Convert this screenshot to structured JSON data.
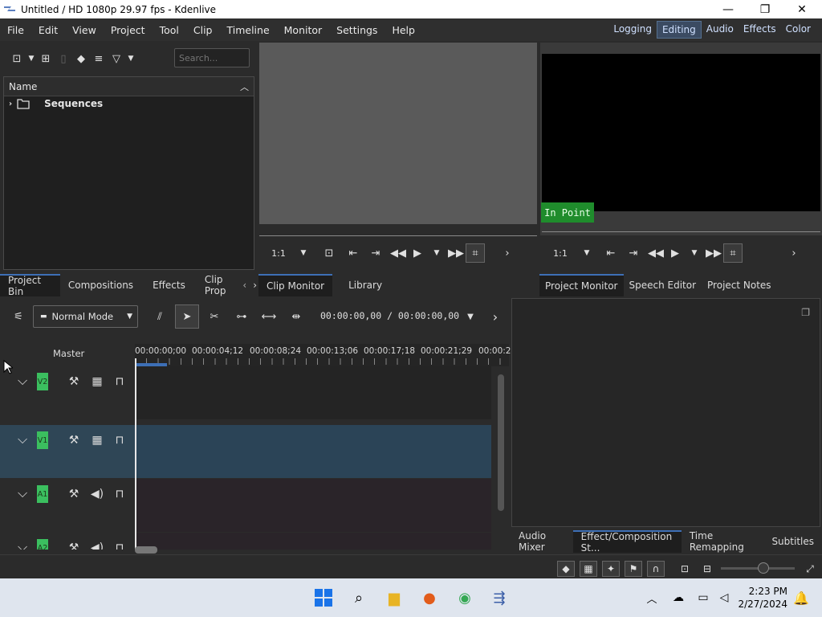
{
  "window": {
    "title": "Untitled / HD 1080p 29.97 fps - Kdenlive",
    "minimize": "—",
    "maximize": "❐",
    "close": "✕"
  },
  "menu": [
    "File",
    "Edit",
    "View",
    "Project",
    "Tool",
    "Clip",
    "Timeline",
    "Monitor",
    "Settings",
    "Help"
  ],
  "layouts": [
    {
      "label": "Logging",
      "active": false
    },
    {
      "label": "Editing",
      "active": true
    },
    {
      "label": "Audio",
      "active": false
    },
    {
      "label": "Effects",
      "active": false
    },
    {
      "label": "Color",
      "active": false
    }
  ],
  "bin": {
    "search_placeholder": "Search...",
    "column_header": "Name",
    "folder": "Sequences",
    "tabs": [
      "Project Bin",
      "Compositions",
      "Effects",
      "Clip Prop"
    ]
  },
  "clip_monitor": {
    "zoom": "1:1",
    "tabs": [
      "Clip Monitor",
      "Library"
    ]
  },
  "project_monitor": {
    "overlay": "In Point",
    "zoom": "1:1",
    "tabs": [
      "Project Monitor",
      "Speech Editor",
      "Project Notes"
    ]
  },
  "timeline": {
    "mode": "Normal Mode",
    "timecode": "00:00:00,00 / 00:00:00,00",
    "master_label": "Master",
    "ruler": [
      "00:00:00;00",
      "00:00:04;12",
      "00:00:08;24",
      "00:00:13;06",
      "00:00:17;18",
      "00:00:21;29",
      "00:00:2"
    ],
    "tracks": [
      {
        "name": "V2",
        "kind": "video",
        "selected": false
      },
      {
        "name": "V1",
        "kind": "video",
        "selected": true
      },
      {
        "name": "A1",
        "kind": "audio",
        "selected": false
      },
      {
        "name": "A2",
        "kind": "audio",
        "selected": false
      }
    ]
  },
  "bottom_tabs": [
    "Audio Mixer",
    "Effect/Composition St...",
    "Time Remapping",
    "Subtitles"
  ],
  "taskbar": {
    "time": "2:23 PM",
    "date": "2/27/2024"
  },
  "colors": {
    "accent": "#3d6fb6",
    "track_label": "#3bbf5f",
    "in_point": "#1f8c2c"
  }
}
